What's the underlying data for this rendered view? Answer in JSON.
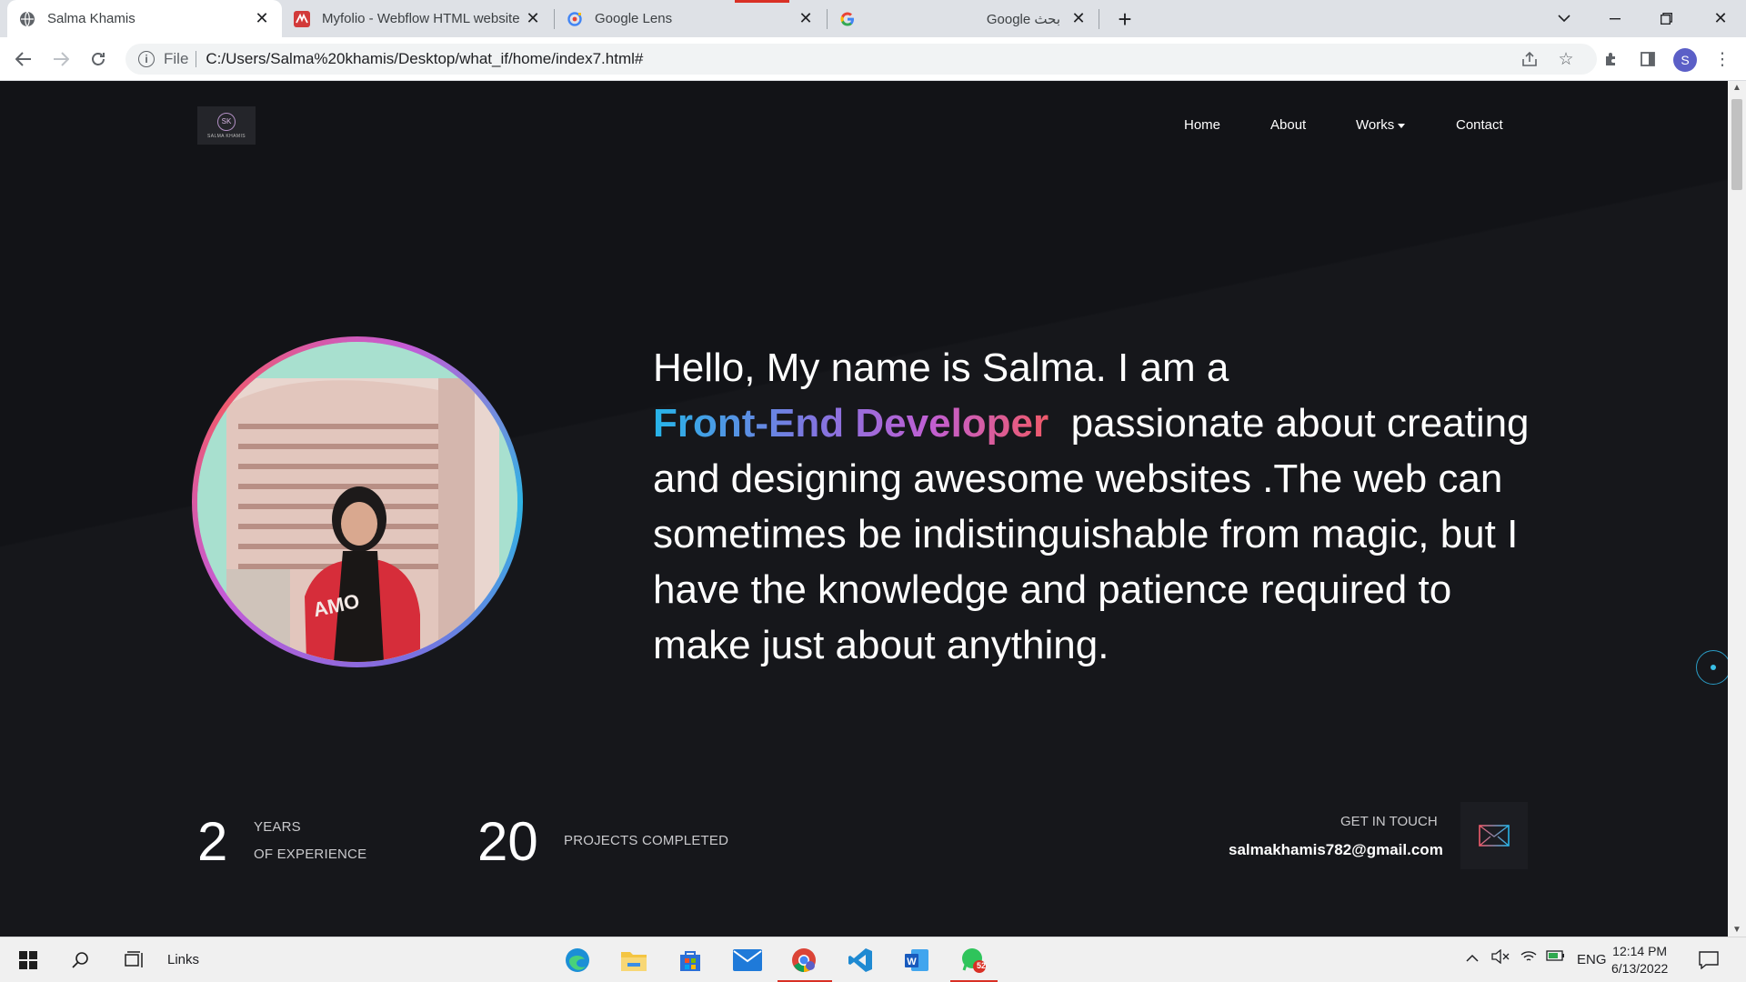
{
  "browser": {
    "tabs": [
      {
        "title": "Salma Khamis",
        "active": true,
        "favicon": "globe-icon"
      },
      {
        "title": "Myfolio - Webflow HTML website",
        "active": false,
        "favicon": "webflow-icon"
      },
      {
        "title": "Google Lens",
        "active": false,
        "favicon": "google-lens-icon"
      },
      {
        "title": "Google بحث",
        "active": false,
        "favicon": "google-icon"
      }
    ],
    "address": {
      "scheme": "File",
      "url": "C:/Users/Salma%20khamis/Desktop/what_if/home/index7.html#"
    },
    "profile_initial": "S"
  },
  "page": {
    "logo": {
      "monogram": "SK",
      "text": "SALMA KHAMIS"
    },
    "nav": [
      "Home",
      "About",
      "Works",
      "Contact"
    ],
    "hero": {
      "line1": "Hello, My name is Salma. I am a",
      "role": "Front-End Developer",
      "rest": " passionate about creating and designing awesome websites .The web can sometimes be indistinguishable from magic, but I have the knowledge and patience required to make just about anything."
    },
    "stats": [
      {
        "number": "2",
        "label_line1": "YEARS",
        "label_line2": "OF EXPERIENCE"
      },
      {
        "number": "20",
        "label_line1": "PROJECTS COMPLETED"
      }
    ],
    "contact": {
      "label": "GET IN TOUCH",
      "email": "salmakhamis782@gmail.com"
    },
    "colors": {
      "background": "#121317",
      "gradient_start": "#26b4e8",
      "gradient_mid": "#c05fd3",
      "gradient_end": "#ef5a6a"
    }
  },
  "taskbar": {
    "links_label": "Links",
    "whatsapp_badge": "52",
    "language": "ENG",
    "time": "12:14 PM",
    "date": "6/13/2022"
  }
}
